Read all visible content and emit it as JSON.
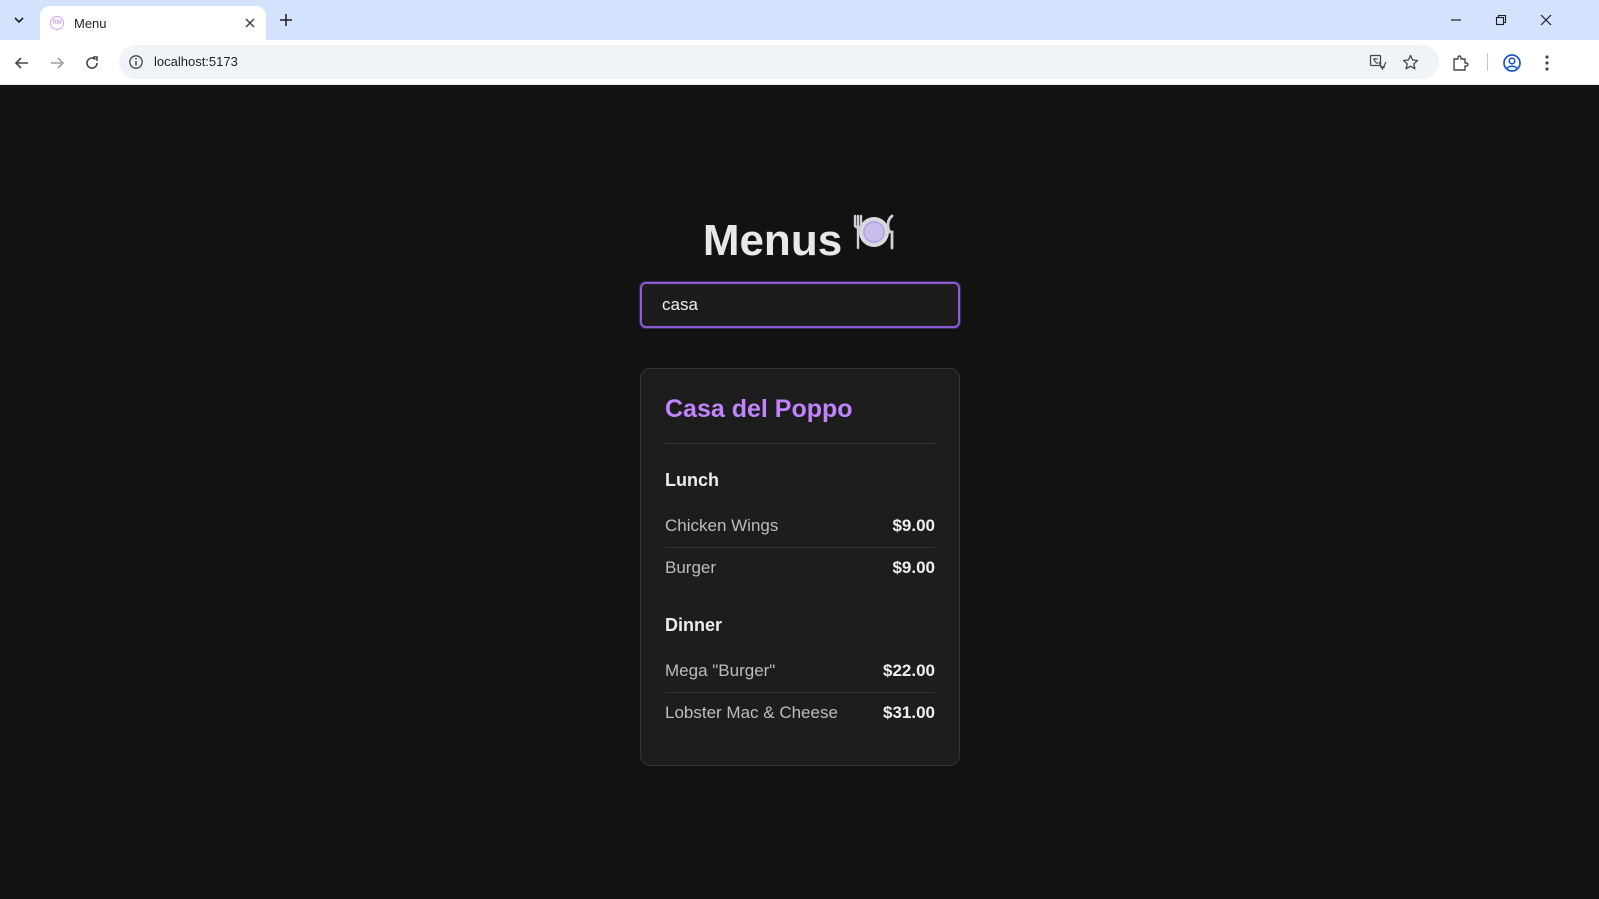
{
  "browser": {
    "tab_title": "Menu",
    "tab_favicon_text": "RM",
    "url": "localhost:5173"
  },
  "page": {
    "title": "Menus",
    "title_icon": "plate-with-cutlery-icon",
    "search": {
      "value": "casa",
      "placeholder": ""
    },
    "restaurants": [
      {
        "name": "Casa del Poppo",
        "sections": [
          {
            "title": "Lunch",
            "items": [
              {
                "name": "Chicken Wings",
                "price": "$9.00"
              },
              {
                "name": "Burger",
                "price": "$9.00"
              }
            ]
          },
          {
            "title": "Dinner",
            "items": [
              {
                "name": "Mega \"Burger\"",
                "price": "$22.00"
              },
              {
                "name": "Lobster Mac & Cheese",
                "price": "$31.00"
              }
            ]
          }
        ]
      }
    ]
  },
  "colors": {
    "background": "#121212",
    "accent": "#c084fc",
    "input_border": "#8b5cd6",
    "card": "#1d1d1d"
  }
}
